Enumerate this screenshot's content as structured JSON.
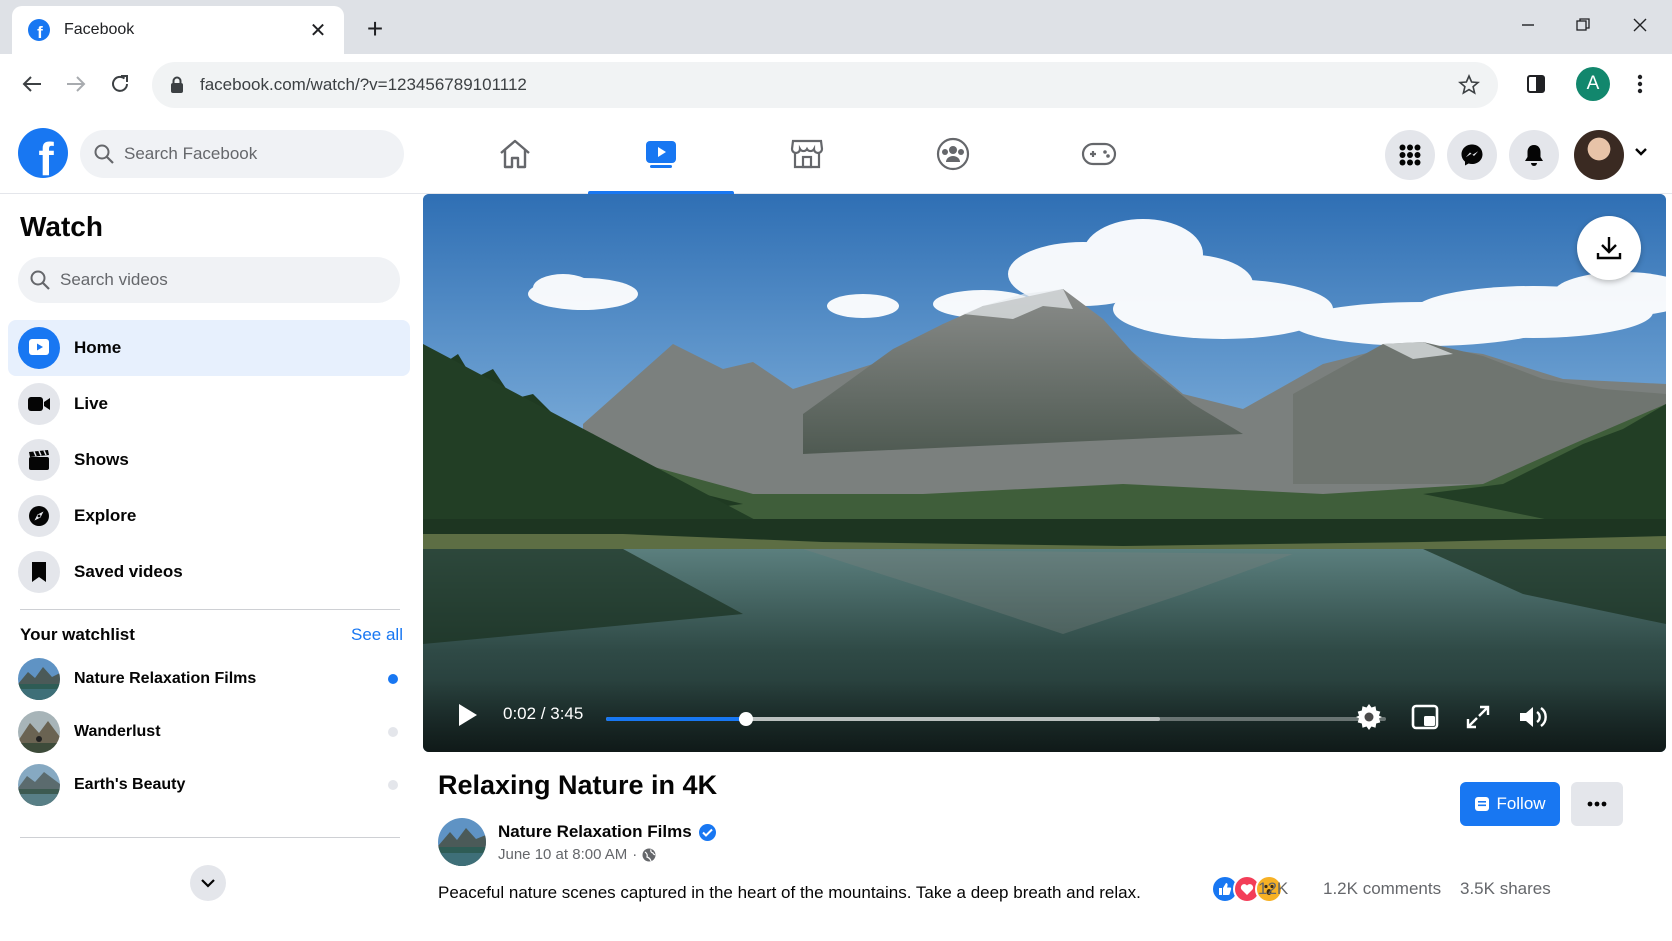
{
  "browser": {
    "tab_title": "Facebook",
    "url": "facebook.com/watch/?v=123456789101112",
    "profile_initial": "A"
  },
  "header": {
    "search_placeholder": "Search Facebook",
    "nav_tabs": [
      "home",
      "watch",
      "marketplace",
      "groups",
      "gaming"
    ],
    "active_tab": "watch"
  },
  "sidebar": {
    "title": "Watch",
    "search_placeholder": "Search videos",
    "menu": [
      {
        "label": "Home",
        "icon": "watch-play-icon",
        "active": true
      },
      {
        "label": "Live",
        "icon": "video-camera-icon",
        "active": false
      },
      {
        "label": "Shows",
        "icon": "clapperboard-icon",
        "active": false
      },
      {
        "label": "Explore",
        "icon": "compass-icon",
        "active": false
      },
      {
        "label": "Saved videos",
        "icon": "bookmark-icon",
        "active": false
      }
    ],
    "watchlist_heading": "Your watchlist",
    "see_all": "See all",
    "watchlist": [
      {
        "label": "Nature Relaxation Films",
        "unread": true
      },
      {
        "label": "Wanderlust",
        "unread": false
      },
      {
        "label": "Earth's Beauty",
        "unread": false
      }
    ]
  },
  "player": {
    "timecode": "0:02 / 3:45",
    "progress": 0.18,
    "buffered": 0.71
  },
  "video": {
    "title": "Relaxing Nature in 4K",
    "channel": "Nature Relaxation Films",
    "posted": "June 10 at 8:00 AM",
    "meta_separator": "·",
    "follow_label": "Follow",
    "description": "Peaceful nature scenes captured in the heart of the mountains. Take a deep breath and relax.",
    "reactions_count": "12K",
    "comments": "1.2K comments",
    "shares": "3.5K shares"
  },
  "colors": {
    "accent": "#1877f2",
    "active_bg": "#e7f0fd",
    "secondary_text": "#65676b"
  }
}
